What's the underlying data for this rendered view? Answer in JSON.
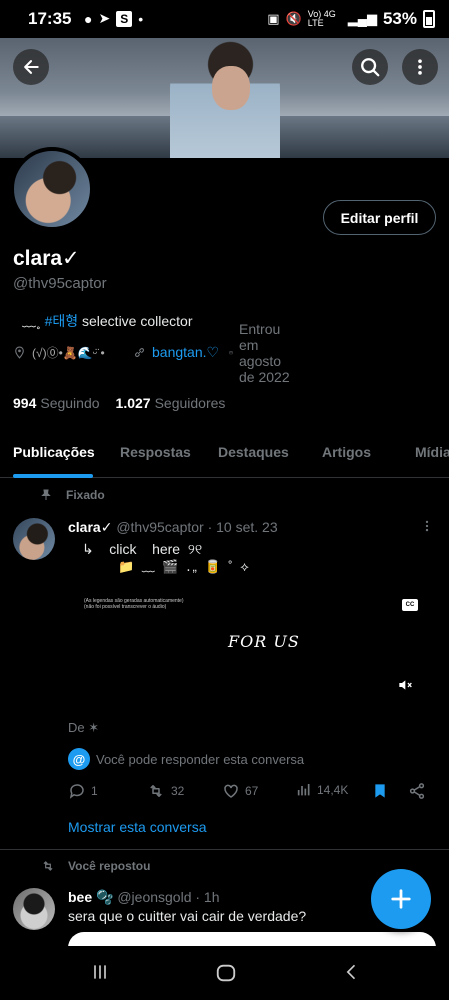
{
  "status_bar": {
    "time": "17:35",
    "network": "Vo) 4G LTE",
    "battery": "53%"
  },
  "profile": {
    "display_name": "clara✓",
    "handle": "@thv95captor",
    "bio_prefix": "﹏˳ ",
    "bio_hashtag": "#태형",
    "bio_rest": " selective collector",
    "location": "(√)⓪•🧸🌊ᵕ̈ •",
    "website": "bangtan.♡",
    "joined": "Entrou em agosto de 2022",
    "following_count": "994",
    "following_label": "Seguindo",
    "followers_count": "1.027",
    "followers_label": "Seguidores",
    "edit_button": "Editar perfil"
  },
  "tabs": [
    {
      "label": "Publicações",
      "active": true
    },
    {
      "label": "Respostas",
      "active": false
    },
    {
      "label": "Destaques",
      "active": false
    },
    {
      "label": "Artigos",
      "active": false
    },
    {
      "label": "Mídia",
      "active": false
    }
  ],
  "pinned_tweet": {
    "pinned_label": "Fixado",
    "name": "clara✓",
    "handle_time": "@thv95captor · 10 set. 23",
    "text": "↳    click    here  ୨୧",
    "emoji_line": "📁 ﹏ 🎬 ․„ 🥫 ˚ ⟡",
    "media_caption_1": "(As legendas são geradas automaticamente)",
    "media_caption_2": "(não foi possível transcrever o áudio)",
    "media_cc": "CC",
    "media_title": "FOR US",
    "from_label": "De ✶",
    "reply_note": "Você pode responder esta conversa",
    "replies": "1",
    "reposts": "32",
    "likes": "67",
    "views": "14,4K",
    "show_conversation": "Mostrar esta conversa"
  },
  "reposted_tweet": {
    "repost_label": "Você repostou",
    "name": "bee 🫧",
    "handle_time": "@jeonsgold · 1h",
    "text": "sera que o cuitter vai cair de verdade?"
  },
  "colors": {
    "accent": "#1d9bf0",
    "background": "#000000",
    "muted_text": "#71767b"
  },
  "icons": [
    "back-arrow-icon",
    "search-icon",
    "more-vertical-icon",
    "location-icon",
    "link-icon",
    "calendar-icon",
    "pin-icon",
    "reply-icon",
    "repost-icon",
    "like-icon",
    "views-icon",
    "bookmark-icon",
    "share-icon",
    "plus-icon"
  ]
}
